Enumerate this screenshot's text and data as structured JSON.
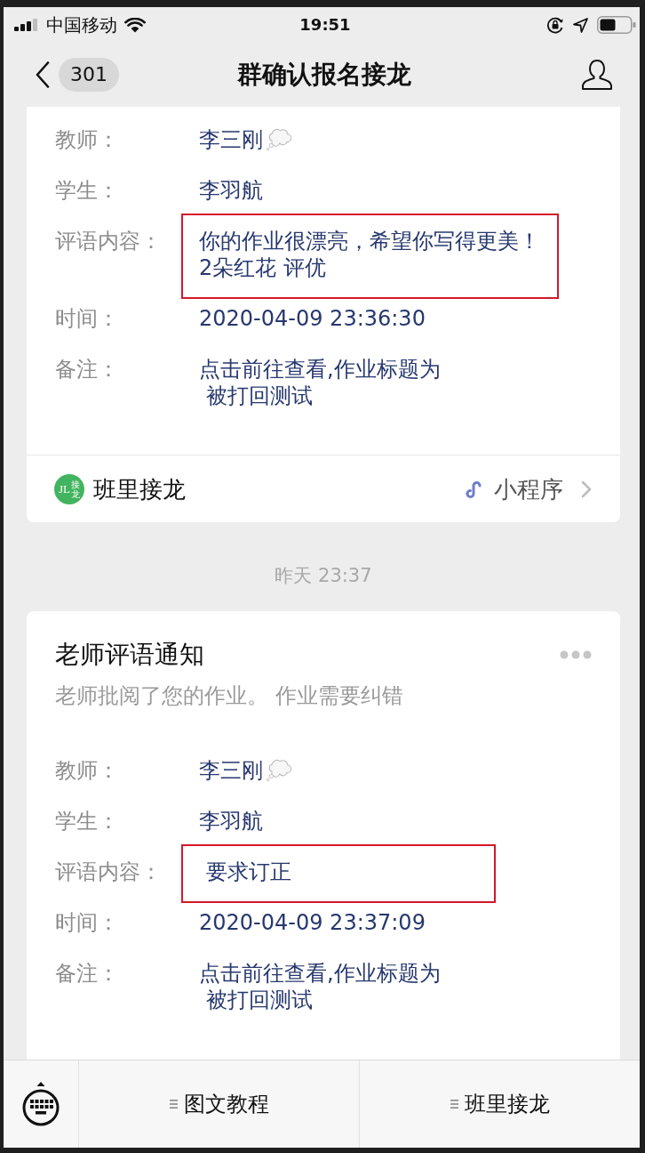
{
  "status_bar": {
    "carrier": "中国移动",
    "time": "19:51"
  },
  "nav_bar": {
    "unread_count": "301",
    "title": "群确认报名接龙"
  },
  "feed": [
    {
      "kind": "card",
      "fields": [
        {
          "label": "教师：",
          "lines": [
            "李三刚"
          ],
          "kind": "emoji",
          "highlighted": false
        },
        {
          "label": "学生：",
          "lines": [
            "李羽航"
          ],
          "kind": "plain",
          "highlighted": false
        },
        {
          "label": "评语内容：",
          "lines": [
            "你的作业很漂亮，希望你写得更美！",
            "2朵红花 评优"
          ],
          "kind": "plain",
          "highlighted": true
        },
        {
          "label": "时间：",
          "lines": [
            "2020-04-09 23:36:30"
          ],
          "kind": "plain",
          "highlighted": false
        },
        {
          "label": "备注：",
          "lines": [
            "点击前往查看,作业标题为",
            " 被打回测试"
          ],
          "kind": "plain",
          "highlighted": false
        }
      ],
      "footer": {
        "logo_text": "JL",
        "logo_subtext": "接龙",
        "app_name": "班里接龙",
        "type_label": "小程序"
      }
    },
    {
      "kind": "time",
      "text": "昨天 23:37"
    },
    {
      "kind": "card",
      "title": "老师评语通知",
      "subtitle": "老师批阅了您的作业。 作业需要纠错",
      "fields": [
        {
          "label": "教师：",
          "lines": [
            "李三刚"
          ],
          "kind": "emoji",
          "highlighted": false
        },
        {
          "label": "学生：",
          "lines": [
            "李羽航"
          ],
          "kind": "plain",
          "highlighted": false
        },
        {
          "label": "评语内容：",
          "lines": [
            " 要求订正"
          ],
          "kind": "plain",
          "highlighted": true
        },
        {
          "label": "时间：",
          "lines": [
            "2020-04-09 23:37:09"
          ],
          "kind": "plain",
          "highlighted": false
        },
        {
          "label": "备注：",
          "lines": [
            "点击前往查看,作业标题为",
            " 被打回测试"
          ],
          "kind": "plain",
          "highlighted": false
        }
      ]
    }
  ],
  "bottom_menu": {
    "items": [
      {
        "label": "图文教程"
      },
      {
        "label": "班里接龙"
      }
    ]
  }
}
